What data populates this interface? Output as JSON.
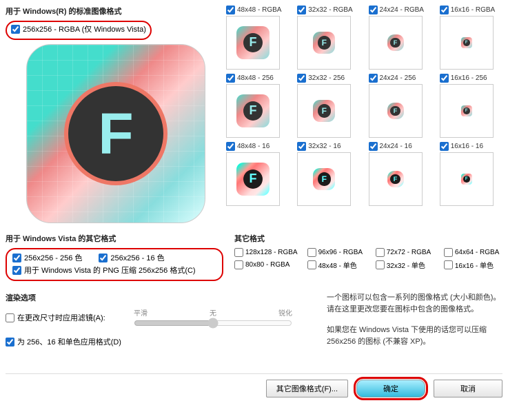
{
  "section1": {
    "title": "用于 Windows(R) 的标准图像格式",
    "main_checkbox_label": "256x256 - RGBA (仅 Windows Vista)"
  },
  "thumb_rows": [
    {
      "size": "s48",
      "labels": [
        "48x48 - RGBA",
        "32x32 - RGBA",
        "24x24 - RGBA",
        "16x16 - RGBA"
      ],
      "sizes": [
        "s48",
        "s32",
        "s24",
        "s16"
      ]
    },
    {
      "size": "s48",
      "labels": [
        "48x48 - 256",
        "32x32 - 256",
        "24x24 - 256",
        "16x16 - 256"
      ],
      "sizes": [
        "s48",
        "s32",
        "s24",
        "s16"
      ]
    },
    {
      "size": "s48",
      "labels": [
        "48x48 - 16",
        "32x32 - 16",
        "24x24 - 16",
        "16x16 - 16"
      ],
      "sizes": [
        "s48",
        "s32",
        "s24",
        "s16"
      ],
      "noisy": true
    }
  ],
  "section2": {
    "title": "用于 Windows Vista 的其它格式",
    "opt1": "256x256 - 256 色",
    "opt2": "256x256 - 16 色",
    "opt3": "用于 Windows Vista 的 PNG 压缩 256x256 格式(C)"
  },
  "section3": {
    "title": "其它格式",
    "items": [
      "128x128 - RGBA",
      "96x96 - RGBA",
      "72x72 - RGBA",
      "64x64 - RGBA",
      "80x80 - RGBA",
      "48x48 - 单色",
      "32x32 - 单色",
      "16x16 - 单色"
    ]
  },
  "render": {
    "title": "渲染选项",
    "slider_smooth": "平滑",
    "slider_none": "无",
    "slider_sharp": "锐化",
    "filter_label": "在更改尺寸时应用滤镜(A):",
    "apply_label": "为 256、16 和单色应用格式(D)"
  },
  "info": {
    "text1": "一个图标可以包含一系列的图像格式 (大小和颜色)。请在这里更改您要在图标中包含的图像格式。",
    "text2": "如果您在 Windows Vista 下使用的话您可以压缩 256x256 的图标 (不兼容 XP)。"
  },
  "buttons": {
    "other": "其它图像格式(F)...",
    "ok": "确定",
    "cancel": "取消"
  }
}
